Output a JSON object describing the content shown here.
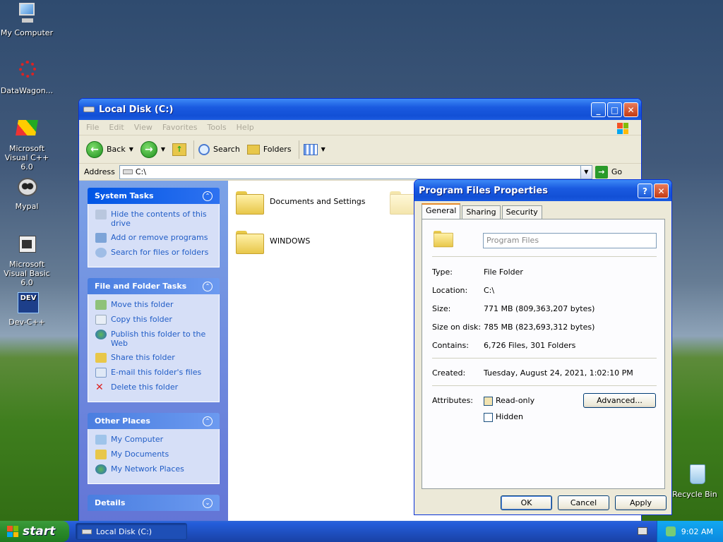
{
  "desktop": {
    "icons": [
      {
        "label": "My Computer"
      },
      {
        "label": "DataWagon..."
      },
      {
        "label": "Microsoft Visual C++ 6.0"
      },
      {
        "label": "Mypal"
      },
      {
        "label": "Microsoft Visual Basic 6.0"
      },
      {
        "label": "Dev-C++"
      },
      {
        "label": "Recycle Bin"
      }
    ]
  },
  "explorer": {
    "title": "Local Disk (C:)",
    "menu": [
      "File",
      "Edit",
      "View",
      "Favorites",
      "Tools",
      "Help"
    ],
    "toolbar": {
      "back": "Back",
      "search": "Search",
      "folders": "Folders"
    },
    "address": {
      "label": "Address",
      "value": "C:\\",
      "go": "Go"
    },
    "system_tasks": {
      "title": "System Tasks",
      "items": [
        "Hide the contents of this drive",
        "Add or remove programs",
        "Search for files or folders"
      ]
    },
    "file_folder_tasks": {
      "title": "File and Folder Tasks",
      "items": [
        "Move this folder",
        "Copy this folder",
        "Publish this folder to the Web",
        "Share this folder",
        "E-mail this folder's files",
        "Delete this folder"
      ]
    },
    "other_places": {
      "title": "Other Places",
      "items": [
        "My Computer",
        "My Documents",
        "My Network Places"
      ]
    },
    "details": {
      "title": "Details"
    },
    "folders": [
      "Documents and Settings",
      "WINDOWS"
    ]
  },
  "dialog": {
    "title": "Program Files Properties",
    "tabs": [
      "General",
      "Sharing",
      "Security"
    ],
    "name_value": "Program Files",
    "fields": [
      {
        "label": "Type:",
        "value": "File Folder"
      },
      {
        "label": "Location:",
        "value": "C:\\"
      },
      {
        "label": "Size:",
        "value": "771 MB (809,363,207 bytes)"
      },
      {
        "label": "Size on disk:",
        "value": "785 MB (823,693,312 bytes)"
      },
      {
        "label": "Contains:",
        "value": "6,726 Files, 301 Folders"
      }
    ],
    "created": {
      "label": "Created:",
      "value": "Tuesday, August 24, 2021, 1:02:10 PM"
    },
    "attributes": {
      "label": "Attributes:",
      "readonly": "Read-only",
      "hidden": "Hidden",
      "advanced": "Advanced..."
    },
    "buttons": {
      "ok": "OK",
      "cancel": "Cancel",
      "apply": "Apply"
    }
  },
  "taskbar": {
    "start": "start",
    "task": "Local Disk (C:)",
    "clock": "9:02 AM"
  }
}
